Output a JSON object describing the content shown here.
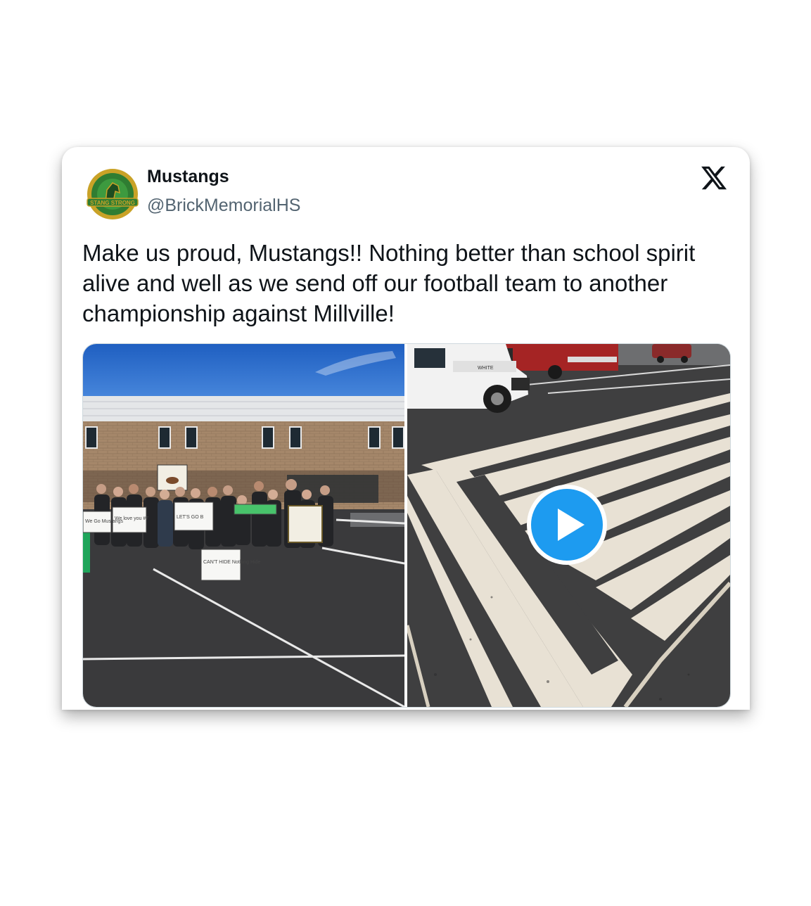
{
  "tweet": {
    "author_name": "Mustangs",
    "author_handle": "@BrickMemorialHS",
    "text": "Make us proud, Mustangs!! Nothing better than school spirit alive and well as we send off our football team to another championship against Millville!",
    "avatar_text": "STANG STRONG",
    "media": {
      "photo_1": {
        "sign_texts": [
          "We Go Mustangs",
          "We love you #7",
          "LET'S GO B",
          "CAN'T HIDE Nothing Hide"
        ]
      },
      "photo_2": {
        "truck_text": "WHITE"
      },
      "play_icon": "play-icon"
    }
  },
  "colors": {
    "accent": "#1d9bf0",
    "name": "#0f1419",
    "handle": "#536471",
    "logo_green": "#2f7d32",
    "logo_gold": "#c9a227"
  },
  "icons": {
    "brand": "x-logo-icon",
    "play": "play-icon"
  }
}
